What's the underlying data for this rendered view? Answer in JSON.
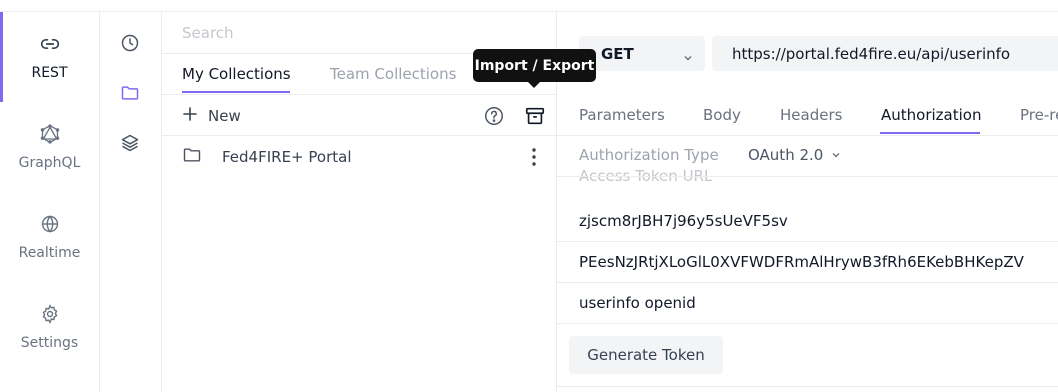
{
  "nav": {
    "items": [
      {
        "label": "REST",
        "icon": "link-icon",
        "active": true
      },
      {
        "label": "GraphQL",
        "icon": "graphql-icon",
        "active": false
      },
      {
        "label": "Realtime",
        "icon": "globe-icon",
        "active": false
      },
      {
        "label": "Settings",
        "icon": "gear-icon",
        "active": false
      }
    ]
  },
  "rail2": {
    "icons": [
      "history-icon",
      "folder-icon",
      "layers-icon"
    ]
  },
  "collections": {
    "search_placeholder": "Search",
    "tabs": [
      "My Collections",
      "Team Collections"
    ],
    "new_label": "New",
    "items": [
      {
        "name": "Fed4FIRE+ Portal"
      }
    ]
  },
  "tooltip": "Import / Export",
  "request": {
    "method": "GET",
    "url": "https://portal.fed4fire.eu/api/userinfo",
    "tabs": [
      "Parameters",
      "Body",
      "Headers",
      "Authorization",
      "Pre-re"
    ],
    "active_tab": "Authorization",
    "auth_type_label": "Authorization Type",
    "auth_type_value": "OAuth 2.0",
    "access_token_url_label": "Access Token URL",
    "client_id": "zjscm8rJBH7j96y5sUeVF5sv",
    "client_secret": "PEesNzJRtjXLoGlL0XVFWDFRmAlHrywB3fRh6EKebBHKepZV",
    "scope": "userinfo openid",
    "generate_token_label": "Generate Token"
  },
  "colors": {
    "accent": "#7c6cf0",
    "tooltip_bg": "#111111"
  }
}
